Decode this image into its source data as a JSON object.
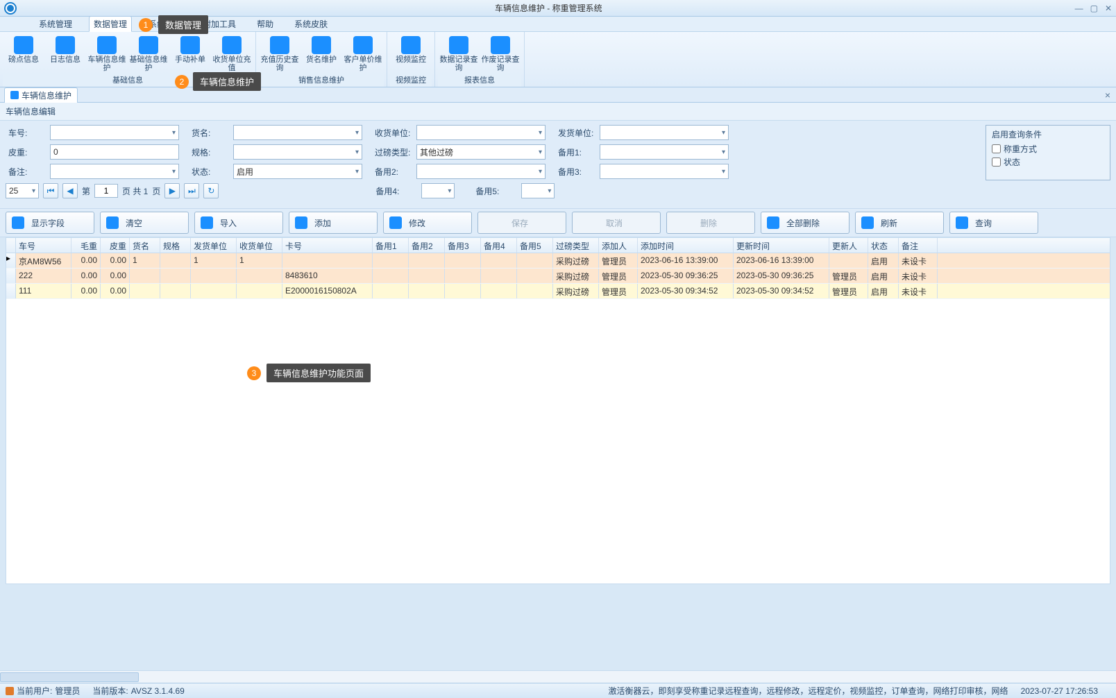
{
  "window": {
    "title": "车辆信息维护 - 称重管理系统"
  },
  "menu": {
    "items": [
      "系统管理",
      "数据管理",
      "系统设置",
      "附加工具",
      "帮助",
      "系统皮肤"
    ],
    "active": 1
  },
  "ribbon": {
    "groups": [
      {
        "label": "基础信息",
        "buttons": [
          "磅点信息",
          "日志信息",
          "车辆信息维护",
          "基础信息维护",
          "手动补单",
          "收货单位充值"
        ]
      },
      {
        "label": "销售信息维护",
        "buttons": [
          "充值历史查询",
          "货名维护",
          "客户单价维护"
        ]
      },
      {
        "label": "视频监控",
        "buttons": [
          "视频监控"
        ]
      },
      {
        "label": "报表信息",
        "buttons": [
          "数据记录查询",
          "作废记录查询"
        ]
      }
    ]
  },
  "tab": {
    "title": "车辆信息维护"
  },
  "panel": {
    "title": "车辆信息编辑"
  },
  "form": {
    "labels": {
      "车号": "车号:",
      "货名": "货名:",
      "收货单位": "收货单位:",
      "发货单位": "发货单位:",
      "皮重": "皮重:",
      "规格": "规格:",
      "过磅类型": "过磅类型:",
      "备用1": "备用1:",
      "备注": "备注:",
      "状态": "状态:",
      "备用2": "备用2:",
      "备用3": "备用3:",
      "备用4": "备用4:",
      "备用5": "备用5:"
    },
    "values": {
      "车号": "",
      "货名": "",
      "收货单位": "",
      "发货单位": "",
      "皮重": "0",
      "规格": "",
      "过磅类型": "其他过磅",
      "备用1": "",
      "备注": "",
      "状态": "启用",
      "备用2": "",
      "备用3": "",
      "备用4": "",
      "备用5": ""
    },
    "query": {
      "header": "启用查询条件",
      "opt1": "称重方式",
      "opt2": "状态"
    }
  },
  "pager": {
    "size": "25",
    "page": "1",
    "page_prefix": "第",
    "page_mid": "页  共 1",
    "page_suffix": "页"
  },
  "toolbar": {
    "fields": "显示字段",
    "clear": "清空",
    "import": "导入",
    "add": "添加",
    "edit": "修改",
    "save": "保存",
    "cancel": "取消",
    "delete": "删除",
    "deleteAll": "全部删除",
    "refresh": "刷新",
    "query": "查询"
  },
  "table": {
    "headers": [
      "车号",
      "毛重",
      "皮重",
      "货名",
      "规格",
      "发货单位",
      "收货单位",
      "卡号",
      "备用1",
      "备用2",
      "备用3",
      "备用4",
      "备用5",
      "过磅类型",
      "添加人",
      "添加时间",
      "更新时间",
      "更新人",
      "状态",
      "备注"
    ],
    "rows": [
      {
        "车号": "京AM8W56",
        "毛重": "0.00",
        "皮重": "0.00",
        "货名": "1",
        "规格": "",
        "发货单位": "1",
        "收货单位": "1",
        "卡号": "",
        "备用1": "",
        "备用2": "",
        "备用3": "",
        "备用4": "",
        "备用5": "",
        "过磅类型": "采购过磅",
        "添加人": "管理员",
        "添加时间": "2023-06-16 13:39:00",
        "更新时间": "2023-06-16 13:39:00",
        "更新人": "",
        "状态": "启用",
        "备注": "未设卡"
      },
      {
        "车号": "222",
        "毛重": "0.00",
        "皮重": "0.00",
        "货名": "",
        "规格": "",
        "发货单位": "",
        "收货单位": "",
        "卡号": "8483610",
        "备用1": "",
        "备用2": "",
        "备用3": "",
        "备用4": "",
        "备用5": "",
        "过磅类型": "采购过磅",
        "添加人": "管理员",
        "添加时间": "2023-05-30 09:36:25",
        "更新时间": "2023-05-30 09:36:25",
        "更新人": "管理员",
        "状态": "启用",
        "备注": "未设卡"
      },
      {
        "车号": "111",
        "毛重": "0.00",
        "皮重": "0.00",
        "货名": "",
        "规格": "",
        "发货单位": "",
        "收货单位": "",
        "卡号": "E2000016150802A",
        "备用1": "",
        "备用2": "",
        "备用3": "",
        "备用4": "",
        "备用5": "",
        "过磅类型": "采购过磅",
        "添加人": "管理员",
        "添加时间": "2023-05-30 09:34:52",
        "更新时间": "2023-05-30 09:34:52",
        "更新人": "管理员",
        "状态": "启用",
        "备注": "未设卡"
      }
    ]
  },
  "callouts": {
    "c1": "数据管理",
    "c2": "车辆信息维护",
    "c3": "车辆信息维护功能页面"
  },
  "status": {
    "user_label": "当前用户:",
    "user": "管理员",
    "ver_label": "当前版本:",
    "ver": "AVSZ 3.1.4.69",
    "msg": "激活衡器云，即刻享受称重记录远程查询，远程修改，远程定价，视频监控，订单查询，网络打印审核，网络",
    "time": "2023-07-27 17:26:53"
  }
}
